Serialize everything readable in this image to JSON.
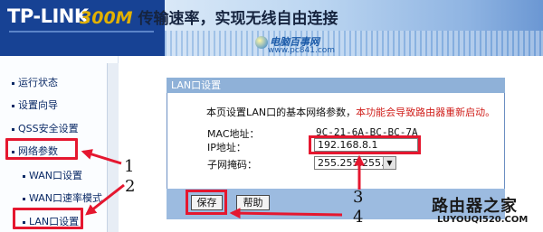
{
  "header": {
    "logo": "TP-LINK",
    "slogan_speed": "300M",
    "slogan_text": "传输速率，实现无线自由连接",
    "watermark_site": "电脑百事网",
    "watermark_url": "www.pc841.com"
  },
  "sidebar": {
    "items": [
      {
        "label": "运行状态"
      },
      {
        "label": "设置向导"
      },
      {
        "label": "QSS安全设置"
      },
      {
        "label": "网络参数"
      },
      {
        "label": "WAN口设置"
      },
      {
        "label": "WAN口速率模式"
      },
      {
        "label": "LAN口设置"
      }
    ]
  },
  "panel": {
    "title": "LAN口设置",
    "desc": "本页设置LAN口的基本网络参数，",
    "desc_warn": "本功能会导致路由器重新启动。",
    "mac_label": "MAC地址：",
    "mac_value": "9C-21-6A-BC-BC-7A",
    "ip_label": "IP地址：",
    "ip_value": "192.168.8.1",
    "mask_label": "子网掩码：",
    "mask_value": "255.255.255.0",
    "save_label": "保存",
    "help_label": "帮助"
  },
  "annotations": {
    "n1": "1",
    "n2": "2",
    "n3": "3",
    "n4": "4",
    "highlight_color": "#e5172f"
  },
  "corner_watermark": {
    "title": "路由器之家",
    "url": "LUYOUQI520.COM"
  }
}
